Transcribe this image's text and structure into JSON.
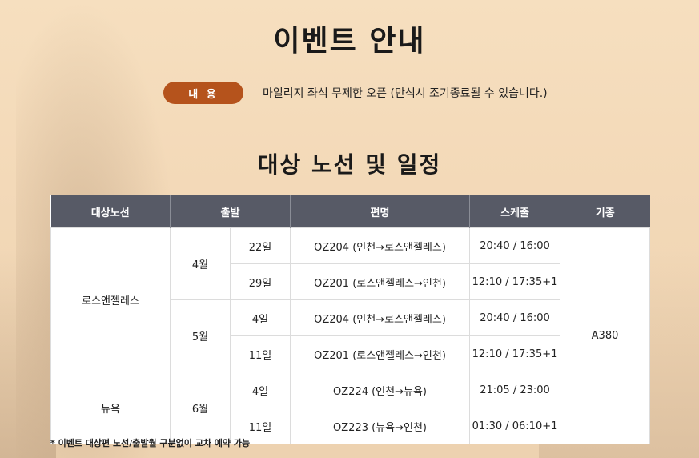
{
  "title": "이벤트 안내",
  "info": {
    "label": "내 용",
    "text": "마일리지 좌석 무제한 오픈 (만석시 조기종료될 수 있습니다.)"
  },
  "subtitle": "대상 노선 및 일정",
  "table": {
    "headers": [
      "대상노선",
      "출발",
      "편명",
      "스케줄",
      "기종"
    ],
    "routes": [
      {
        "name": "로스앤젤레스",
        "months": [
          {
            "month": "4월",
            "days": [
              {
                "day": "22일",
                "flight": "OZ204 (인천→로스앤젤레스)",
                "schedule": "20:40 / 16:00"
              },
              {
                "day": "29일",
                "flight": "OZ201 (로스앤젤레스→인천)",
                "schedule": "12:10 / 17:35+1"
              }
            ]
          },
          {
            "month": "5월",
            "days": [
              {
                "day": "4일",
                "flight": "OZ204 (인천→로스앤젤레스)",
                "schedule": "20:40 / 16:00"
              },
              {
                "day": "11일",
                "flight": "OZ201 (로스앤젤레스→인천)",
                "schedule": "12:10 / 17:35+1"
              }
            ]
          }
        ]
      },
      {
        "name": "뉴욕",
        "months": [
          {
            "month": "6월",
            "days": [
              {
                "day": "4일",
                "flight": "OZ224 (인천→뉴욕)",
                "schedule": "21:05 / 23:00"
              },
              {
                "day": "11일",
                "flight": "OZ223 (뉴욕→인천)",
                "schedule": "01:30 / 06:10+1"
              }
            ]
          }
        ]
      }
    ],
    "aircraft": "A380"
  },
  "footnote": "* 이벤트 대상편 노선/출발월 구분없이 교차 예약 가능"
}
